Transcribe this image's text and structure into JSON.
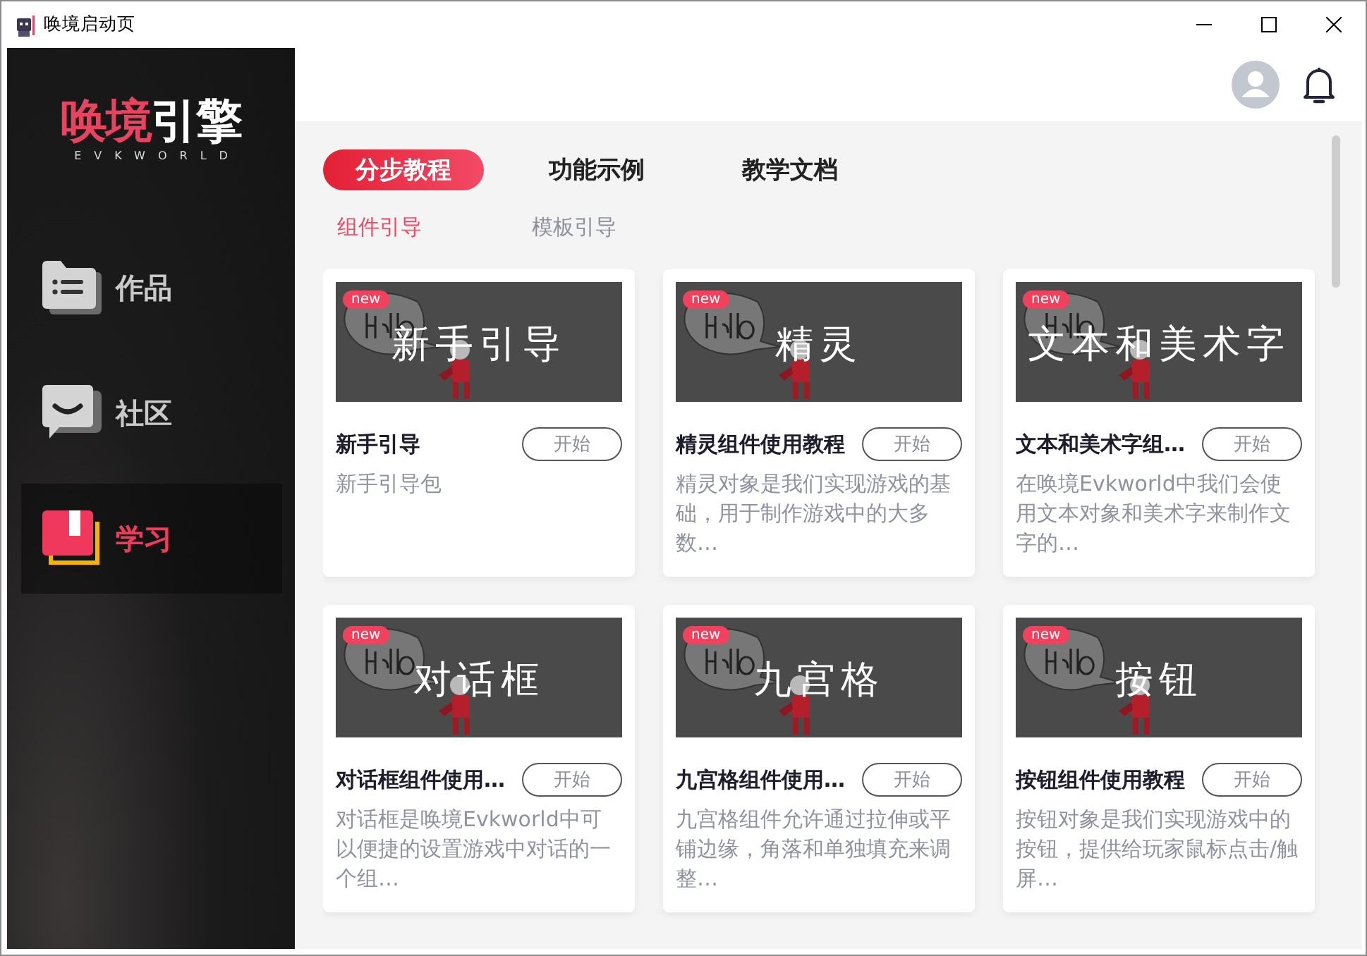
{
  "window": {
    "title": "唤境启动页"
  },
  "logo": {
    "accent": "唤境",
    "text": "引擎",
    "subtitle": "EVKWORLD"
  },
  "sidebar": {
    "items": [
      {
        "label": "作品",
        "kind": "works",
        "selected": false
      },
      {
        "label": "社区",
        "kind": "community",
        "selected": false
      },
      {
        "label": "学习",
        "kind": "learn",
        "selected": true
      }
    ]
  },
  "tabs": [
    {
      "label": "分步教程",
      "selected": true
    },
    {
      "label": "功能示例",
      "selected": false
    },
    {
      "label": "教学文档",
      "selected": false
    }
  ],
  "subtabs": [
    {
      "label": "组件引导",
      "selected": true
    },
    {
      "label": "模板引导",
      "selected": false
    }
  ],
  "cards": [
    {
      "cover_title": "新手引导",
      "badge": "new",
      "title": "新手引导",
      "button": "开始",
      "description": "新手引导包"
    },
    {
      "cover_title": "精灵",
      "badge": "new",
      "title": "精灵组件使用教程",
      "button": "开始",
      "description": "精灵对象是我们实现游戏的基础，用于制作游戏中的大多数…"
    },
    {
      "cover_title": "文本和美术字",
      "badge": "new",
      "title": "文本和美术字组…",
      "button": "开始",
      "description": "在唤境Evkworld中我们会使用文本对象和美术字来制作文字的…"
    },
    {
      "cover_title": "对话框",
      "badge": "new",
      "title": "对话框组件使用…",
      "button": "开始",
      "description": "对话框是唤境Evkworld中可以便捷的设置游戏中对话的一个组…"
    },
    {
      "cover_title": "九宫格",
      "badge": "new",
      "title": "九宫格组件使用…",
      "button": "开始",
      "description": "九宫格组件允许通过拉伸或平铺边缘，角落和单独填充来调整…"
    },
    {
      "cover_title": "按钮",
      "badge": "new",
      "title": "按钮组件使用教程",
      "button": "开始",
      "description": "按钮对象是我们实现游戏中的按钮，提供给玩家鼠标点击/触屏…"
    }
  ]
}
